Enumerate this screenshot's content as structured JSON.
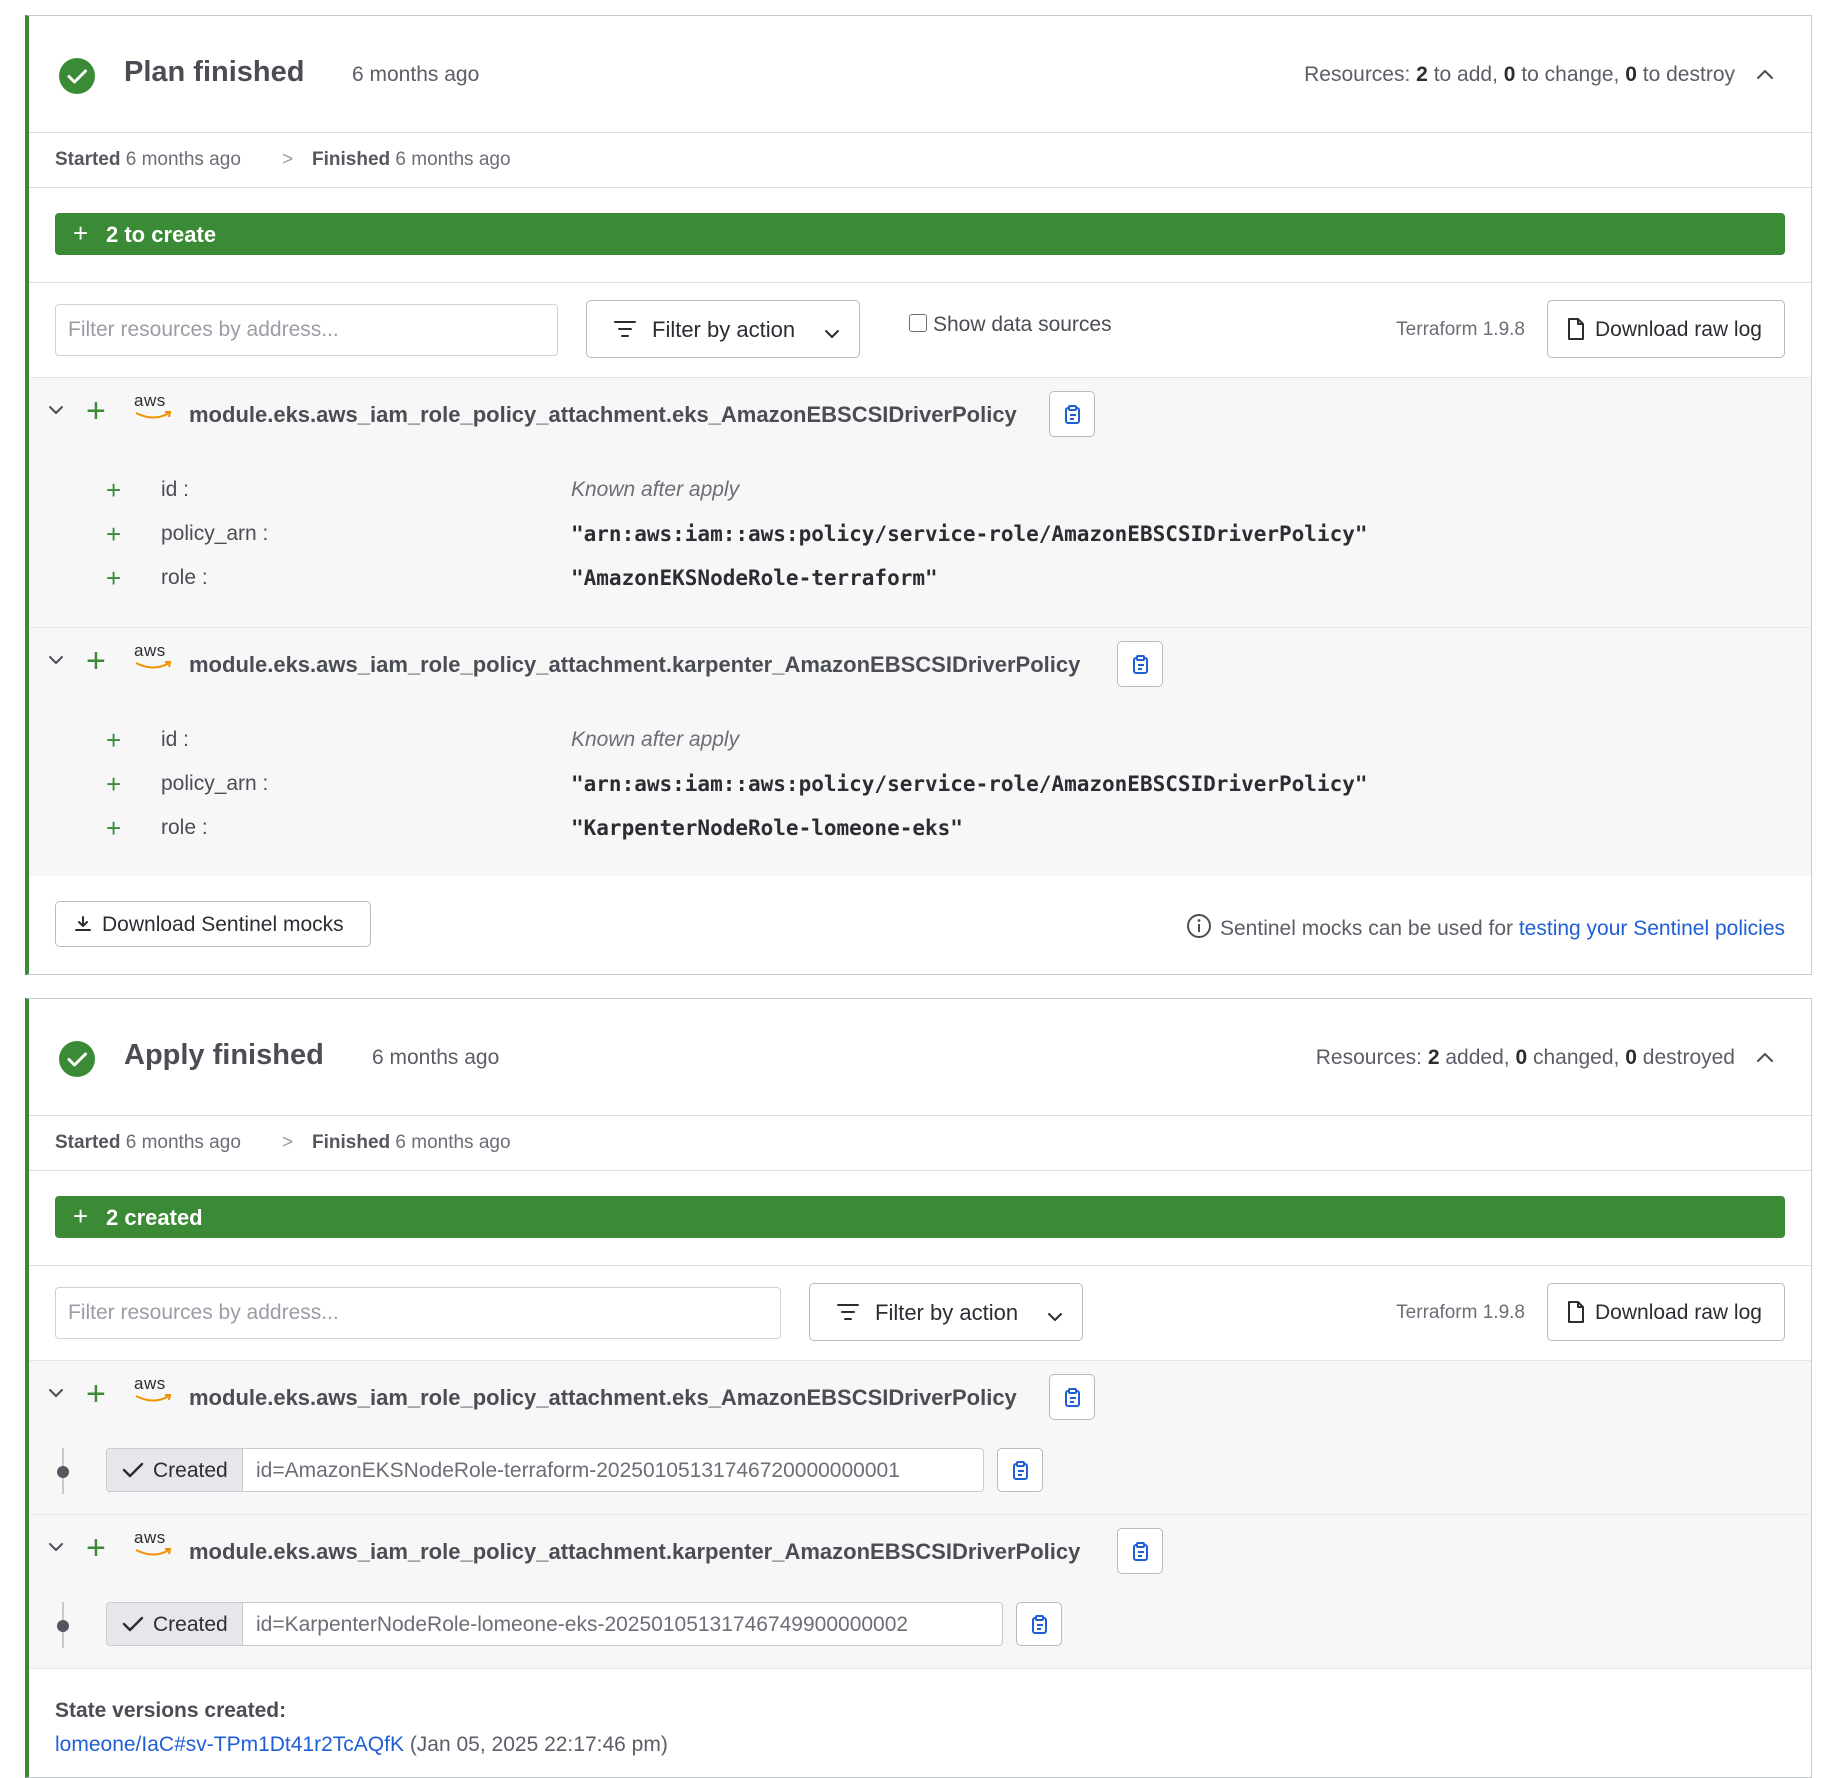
{
  "plan": {
    "title": "Plan finished",
    "ago": "6 months ago",
    "resources_prefix": "Resources:",
    "add_count": "2",
    "add_text": "to add,",
    "change_count": "0",
    "change_text": "to change,",
    "destroy_count": "0",
    "destroy_text": "to destroy",
    "started_label": "Started",
    "started_value": "6 months ago",
    "sep": ">",
    "finished_label": "Finished",
    "finished_value": "6 months ago",
    "summary": "2 to create",
    "filter_placeholder": "Filter resources by address...",
    "filter_action": "Filter by action",
    "show_data_sources": "Show data sources",
    "terraform_version": "Terraform 1.9.8",
    "download_raw_log": "Download raw log",
    "resources": [
      {
        "address": "module.eks.aws_iam_role_policy_attachment.eks_AmazonEBSCSIDriverPolicy",
        "attrs": [
          {
            "key": "id :",
            "value": "Known after apply"
          },
          {
            "key": "policy_arn :",
            "value": "\"arn:aws:iam::aws:policy/service-role/AmazonEBSCSIDriverPolicy\""
          },
          {
            "key": "role :",
            "value": "\"AmazonEKSNodeRole-terraform\""
          }
        ]
      },
      {
        "address": "module.eks.aws_iam_role_policy_attachment.karpenter_AmazonEBSCSIDriverPolicy",
        "attrs": [
          {
            "key": "id :",
            "value": "Known after apply"
          },
          {
            "key": "policy_arn :",
            "value": "\"arn:aws:iam::aws:policy/service-role/AmazonEBSCSIDriverPolicy\""
          },
          {
            "key": "role :",
            "value": "\"KarpenterNodeRole-lomeone-eks\""
          }
        ]
      }
    ],
    "download_sentinel": "Download Sentinel mocks",
    "sentinel_info": "Sentinel mocks can be used for",
    "sentinel_link": "testing your Sentinel policies"
  },
  "apply": {
    "title": "Apply finished",
    "ago": "6 months ago",
    "resources_prefix": "Resources:",
    "added_count": "2",
    "added_text": "added,",
    "changed_count": "0",
    "changed_text": "changed,",
    "destroyed_count": "0",
    "destroyed_text": "destroyed",
    "started_label": "Started",
    "started_value": "6 months ago",
    "sep": ">",
    "finished_label": "Finished",
    "finished_value": "6 months ago",
    "summary": "2 created",
    "filter_placeholder": "Filter resources by address...",
    "filter_action": "Filter by action",
    "terraform_version": "Terraform 1.9.8",
    "download_raw_log": "Download raw log",
    "resources": [
      {
        "address": "module.eks.aws_iam_role_policy_attachment.eks_AmazonEBSCSIDriverPolicy",
        "status": "Created",
        "id": "id=AmazonEKSNodeRole-terraform-20250105131746720000000001"
      },
      {
        "address": "module.eks.aws_iam_role_policy_attachment.karpenter_AmazonEBSCSIDriverPolicy",
        "status": "Created",
        "id": "id=KarpenterNodeRole-lomeone-eks-20250105131746749900000002"
      }
    ],
    "state_heading": "State versions created:",
    "state_link": "lomeone/IaC#sv-TPm1Dt41r2TcAQfK",
    "state_date": "(Jan 05, 2025 22:17:46 pm)"
  },
  "icons": {
    "aws_logo": "aws",
    "success": "check-circle-icon",
    "collapse": "chevron-up-icon",
    "expand": "chevron-down-icon"
  },
  "colors": {
    "success_green": "#3b8a35",
    "link_blue": "#1f5fd6"
  }
}
